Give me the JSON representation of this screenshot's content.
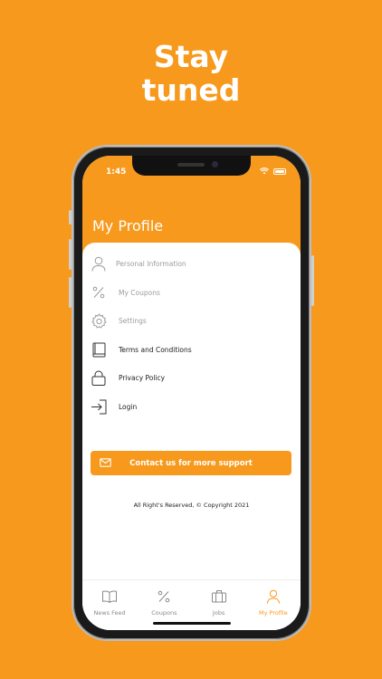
{
  "promo": {
    "headline_line1": "Stay",
    "headline_line2": "tuned"
  },
  "status_bar": {
    "time": "1:45"
  },
  "header": {
    "title": "My Profile"
  },
  "menu": {
    "items": [
      {
        "label": "Personal Information",
        "icon": "person-icon"
      },
      {
        "label": "My Coupons",
        "icon": "percent-icon"
      },
      {
        "label": "Settings",
        "icon": "gear-icon"
      },
      {
        "label": "Terms and Conditions",
        "icon": "book-icon"
      },
      {
        "label": "Privacy Policy",
        "icon": "lock-icon"
      },
      {
        "label": "Login",
        "icon": "login-icon"
      }
    ]
  },
  "contact": {
    "label": "Contact us for more support",
    "icon": "mail-icon"
  },
  "footer": {
    "copyright": "All Right's Reserved, © Copyright 2021"
  },
  "tabbar": {
    "tabs": [
      {
        "label": "News Feed",
        "icon": "book-open-icon",
        "active": false
      },
      {
        "label": "Coupons",
        "icon": "percent-icon",
        "active": false
      },
      {
        "label": "Jobs",
        "icon": "briefcase-icon",
        "active": false
      },
      {
        "label": "My Profile",
        "icon": "person-icon",
        "active": true
      }
    ]
  },
  "colors": {
    "accent": "#F7991C",
    "background": "#F7991C",
    "card": "#FFFFFF",
    "muted_text": "#9B9B9B"
  }
}
